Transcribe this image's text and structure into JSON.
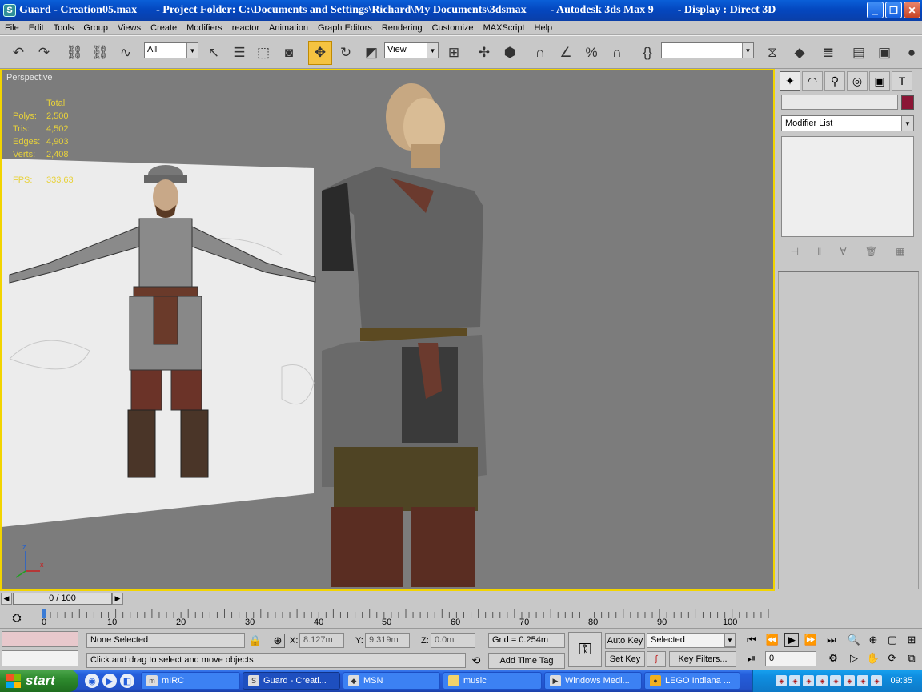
{
  "titlebar": {
    "file": "Guard - Creation05.max",
    "project": "- Project Folder: C:\\Documents and Settings\\Richard\\My Documents\\3dsmax",
    "app": "- Autodesk 3ds Max 9",
    "display": "- Display : Direct 3D",
    "app_icon": "3ds-max-logo-icon"
  },
  "menu": [
    "File",
    "Edit",
    "Tools",
    "Group",
    "Views",
    "Create",
    "Modifiers",
    "reactor",
    "Animation",
    "Graph Editors",
    "Rendering",
    "Customize",
    "MAXScript",
    "Help"
  ],
  "toolbar": {
    "selection_filter": "All",
    "reference_coord": "View",
    "named_selection": ""
  },
  "viewport": {
    "label": "Perspective",
    "stats_header": "Total",
    "stats": [
      {
        "key": "Polys:",
        "value": "2,500"
      },
      {
        "key": "Tris:",
        "value": "4,502"
      },
      {
        "key": "Edges:",
        "value": "4,903"
      },
      {
        "key": "Verts:",
        "value": "2,408"
      }
    ],
    "fps_key": "FPS:",
    "fps_value": "333.63",
    "axis_x": "x",
    "axis_z": "z"
  },
  "command_panel": {
    "object_name": "",
    "object_color": "#8b1535",
    "modifier_list": "Modifier List"
  },
  "timeline": {
    "frame_display": "0 / 100",
    "ticks": [
      "0",
      "10",
      "20",
      "30",
      "40",
      "50",
      "60",
      "70",
      "80",
      "90",
      "100"
    ]
  },
  "status": {
    "selection": "None Selected",
    "prompt": "Click and drag to select and move objects",
    "x_label": "X:",
    "x_value": "8.127m",
    "y_label": "Y:",
    "y_value": "9.319m",
    "z_label": "Z:",
    "z_value": "0.0m",
    "grid": "Grid = 0.254m",
    "add_time_tag": "Add Time Tag",
    "auto_key": "Auto Key",
    "set_key": "Set Key",
    "key_mode": "Selected",
    "key_filters": "Key Filters...",
    "current_frame": "0"
  },
  "taskbar": {
    "start": "start",
    "tasks": [
      {
        "label": "mIRC",
        "icon": "mirc-icon",
        "active": false
      },
      {
        "label": "Guard - Creati...",
        "icon": "3ds-max-icon",
        "active": true
      },
      {
        "label": "MSN",
        "icon": "msn-icon",
        "active": false
      },
      {
        "label": "music",
        "icon": "folder-icon",
        "active": false
      },
      {
        "label": "Windows Medi...",
        "icon": "media-player-icon",
        "active": false
      },
      {
        "label": "LEGO Indiana ...",
        "icon": "game-icon",
        "active": false
      }
    ],
    "clock": "09:35"
  }
}
